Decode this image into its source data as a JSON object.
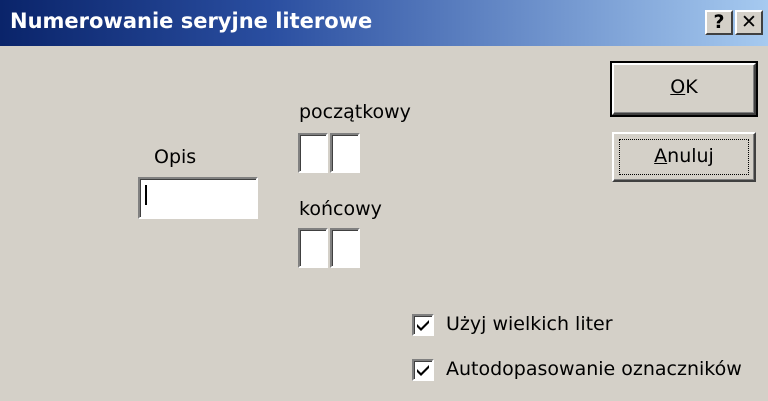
{
  "window": {
    "title": "Numerowanie seryjne literowe",
    "help_label": "?",
    "close_label": "✕"
  },
  "description": {
    "label": "Opis",
    "value": ""
  },
  "start": {
    "label": "początkowy",
    "char1": "",
    "char2": ""
  },
  "end": {
    "label": "końcowy",
    "char1": "",
    "char2": ""
  },
  "buttons": {
    "ok_label": "OK",
    "ok_mnemonic": "O",
    "ok_rest": "K",
    "cancel_label": "Anuluj",
    "cancel_mnemonic": "A",
    "cancel_rest": "nuluj"
  },
  "options": {
    "uppercase": {
      "label": "Użyj wielkich liter",
      "checked": true
    },
    "autofit": {
      "label": "Autodopasowanie oznaczników",
      "checked": true
    }
  }
}
